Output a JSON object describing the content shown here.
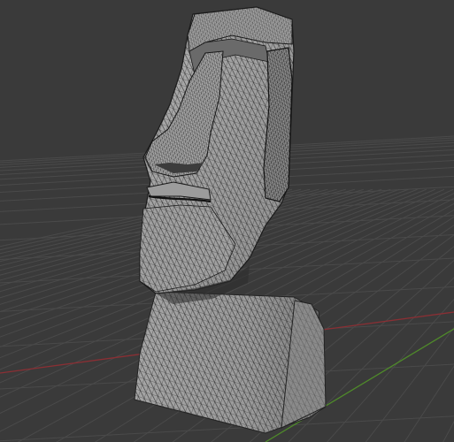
{
  "viewport": {
    "kind": "3d-viewport",
    "shading": "wireframe-on-shaded",
    "object": "moai-head-mesh"
  },
  "colors": {
    "background": "#3a3a3a",
    "grid_line": "#4a4a4a",
    "x_axis": "#8a2f34",
    "y_axis": "#4f8a2a",
    "mesh_fill": "#9b9b9b",
    "mesh_fill_light": "#b5b5b5",
    "mesh_fill_dark": "#6f6f6f",
    "wireframe": "#1e1e1e",
    "cut_face": "#8c8c8c"
  }
}
